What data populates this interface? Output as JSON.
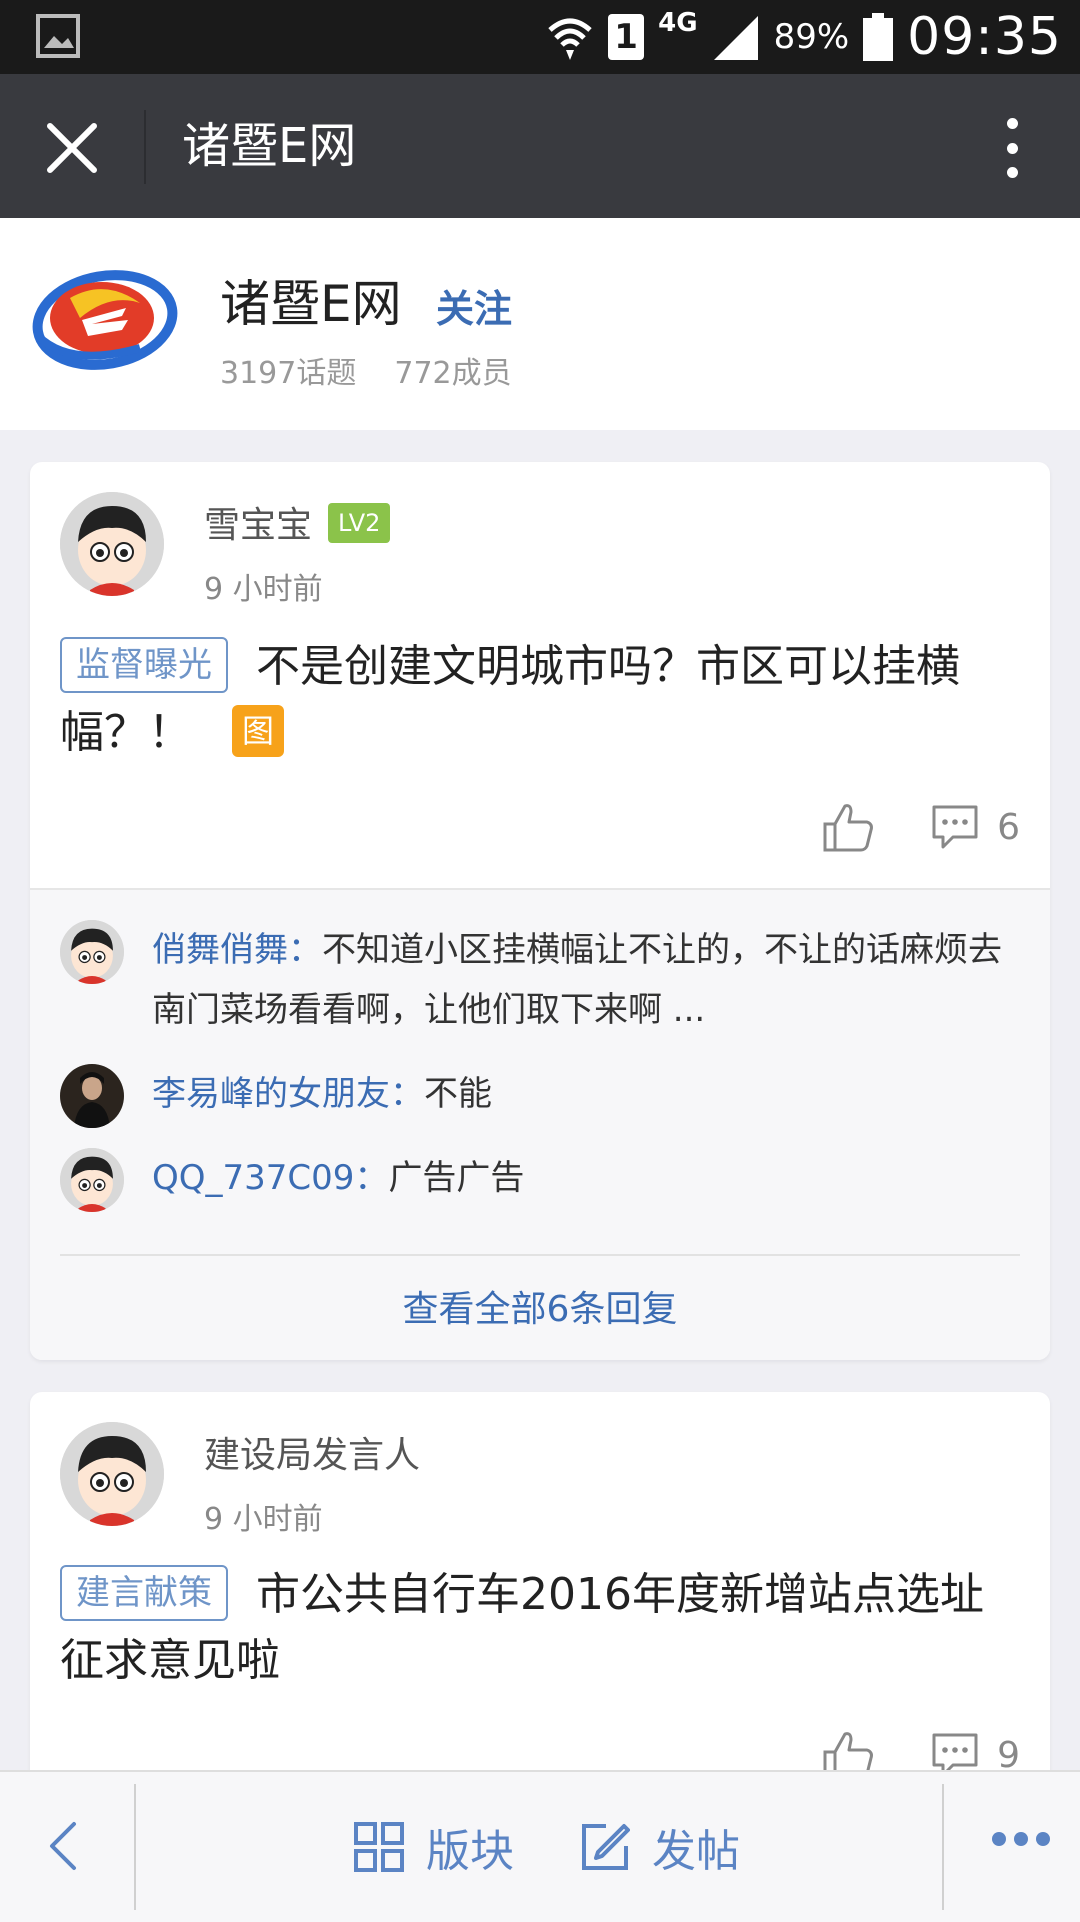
{
  "status_bar": {
    "network_type": "4G",
    "sim": "1",
    "battery": "89%",
    "time": "09:35"
  },
  "titlebar": {
    "title": "诸暨E网"
  },
  "group": {
    "name": "诸暨E网",
    "follow_label": "关注",
    "topics": "3197话题",
    "members": "772成员"
  },
  "posts": [
    {
      "author": "雪宝宝",
      "level": "LV2",
      "time": "9 小时前",
      "tag": "监督曝光",
      "text": "不是创建文明城市吗？市区可以挂横幅？！",
      "image_badge": "图",
      "comment_count": "6",
      "replies": [
        {
          "name": "俏舞俏舞：",
          "text": "不知道小区挂横幅让不让的，不让的话麻烦去南门菜场看看啊，让他们取下来啊 ..."
        },
        {
          "name": "李易峰的女朋友：",
          "text": "不能"
        },
        {
          "name": "QQ_737C09：",
          "text": "广告广告"
        }
      ],
      "view_all": "查看全部6条回复"
    },
    {
      "author": "建设局发言人",
      "time": "9 小时前",
      "tag": "建言献策",
      "text": "市公共自行车2016年度新增站点选址征求意见啦",
      "comment_count": "9"
    }
  ],
  "bottom_bar": {
    "blocks_label": "版块",
    "post_label": "发帖"
  }
}
